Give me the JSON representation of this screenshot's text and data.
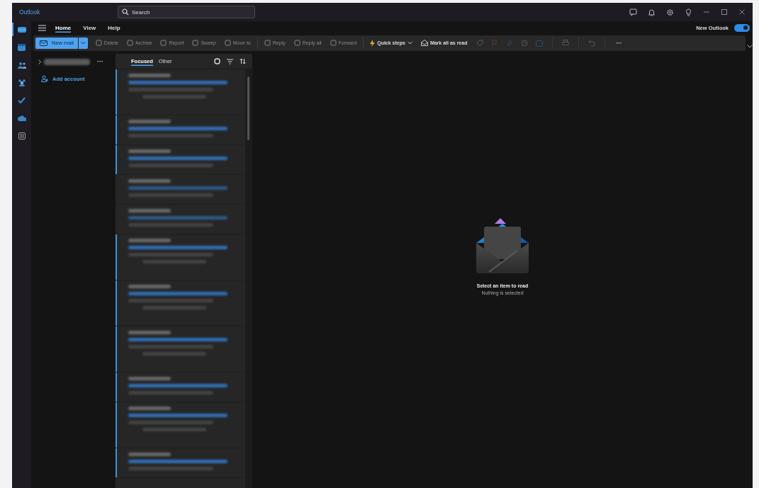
{
  "window": {
    "title": "Outlook"
  },
  "search": {
    "placeholder": "Search"
  },
  "rail": [
    {
      "kind": "mail",
      "selected": true
    },
    {
      "kind": "calendar",
      "selected": false
    },
    {
      "kind": "people",
      "selected": false
    },
    {
      "kind": "groups",
      "selected": false
    },
    {
      "kind": "todo",
      "selected": false
    },
    {
      "kind": "cloud",
      "selected": false
    },
    {
      "kind": "apps",
      "selected": false
    }
  ],
  "tabs": [
    {
      "label": "Home",
      "selected": true
    },
    {
      "label": "View",
      "selected": false
    },
    {
      "label": "Help",
      "selected": false
    }
  ],
  "new_outlook": {
    "label": "New Outlook",
    "on": true
  },
  "toolbar": [
    {
      "kind": "primary",
      "label": "New mail"
    },
    {
      "kind": "action",
      "label": "Delete",
      "disabled": true
    },
    {
      "kind": "action",
      "label": "Archive",
      "disabled": true
    },
    {
      "kind": "action",
      "label": "Report",
      "disabled": true
    },
    {
      "kind": "action",
      "label": "Sweep",
      "disabled": true
    },
    {
      "kind": "action",
      "label": "Move to",
      "disabled": true
    },
    {
      "kind": "separator"
    },
    {
      "kind": "action",
      "label": "Reply",
      "disabled": true
    },
    {
      "kind": "action",
      "label": "Reply all",
      "disabled": true
    },
    {
      "kind": "action",
      "label": "Forward",
      "disabled": true
    },
    {
      "kind": "separator"
    },
    {
      "kind": "action",
      "label": "Quick steps",
      "disabled": false
    },
    {
      "kind": "action",
      "label": "Mark all as read",
      "disabled": false
    },
    {
      "kind": "icon",
      "disabled": true
    },
    {
      "kind": "more",
      "label": "···"
    }
  ],
  "folder_pane": {
    "more": "···",
    "add_account": "Add account"
  },
  "list_tabs": [
    {
      "label": "Focused",
      "selected": true
    },
    {
      "label": "Other",
      "selected": false
    }
  ],
  "messages": [
    {
      "kind": "tall",
      "unread": true
    },
    {
      "kind": "short",
      "unread": true
    },
    {
      "kind": "short",
      "unread": true
    },
    {
      "kind": "short",
      "unread": false
    },
    {
      "kind": "short",
      "unread": false
    },
    {
      "kind": "tall",
      "unread": true
    },
    {
      "kind": "tall",
      "unread": true
    },
    {
      "kind": "tall",
      "unread": true
    },
    {
      "kind": "short",
      "unread": true
    },
    {
      "kind": "tall",
      "unread": true
    },
    {
      "kind": "short",
      "unread": true
    }
  ],
  "reading_pane": {
    "title": "Select an item to read",
    "subtitle": "Nothing is selected"
  }
}
